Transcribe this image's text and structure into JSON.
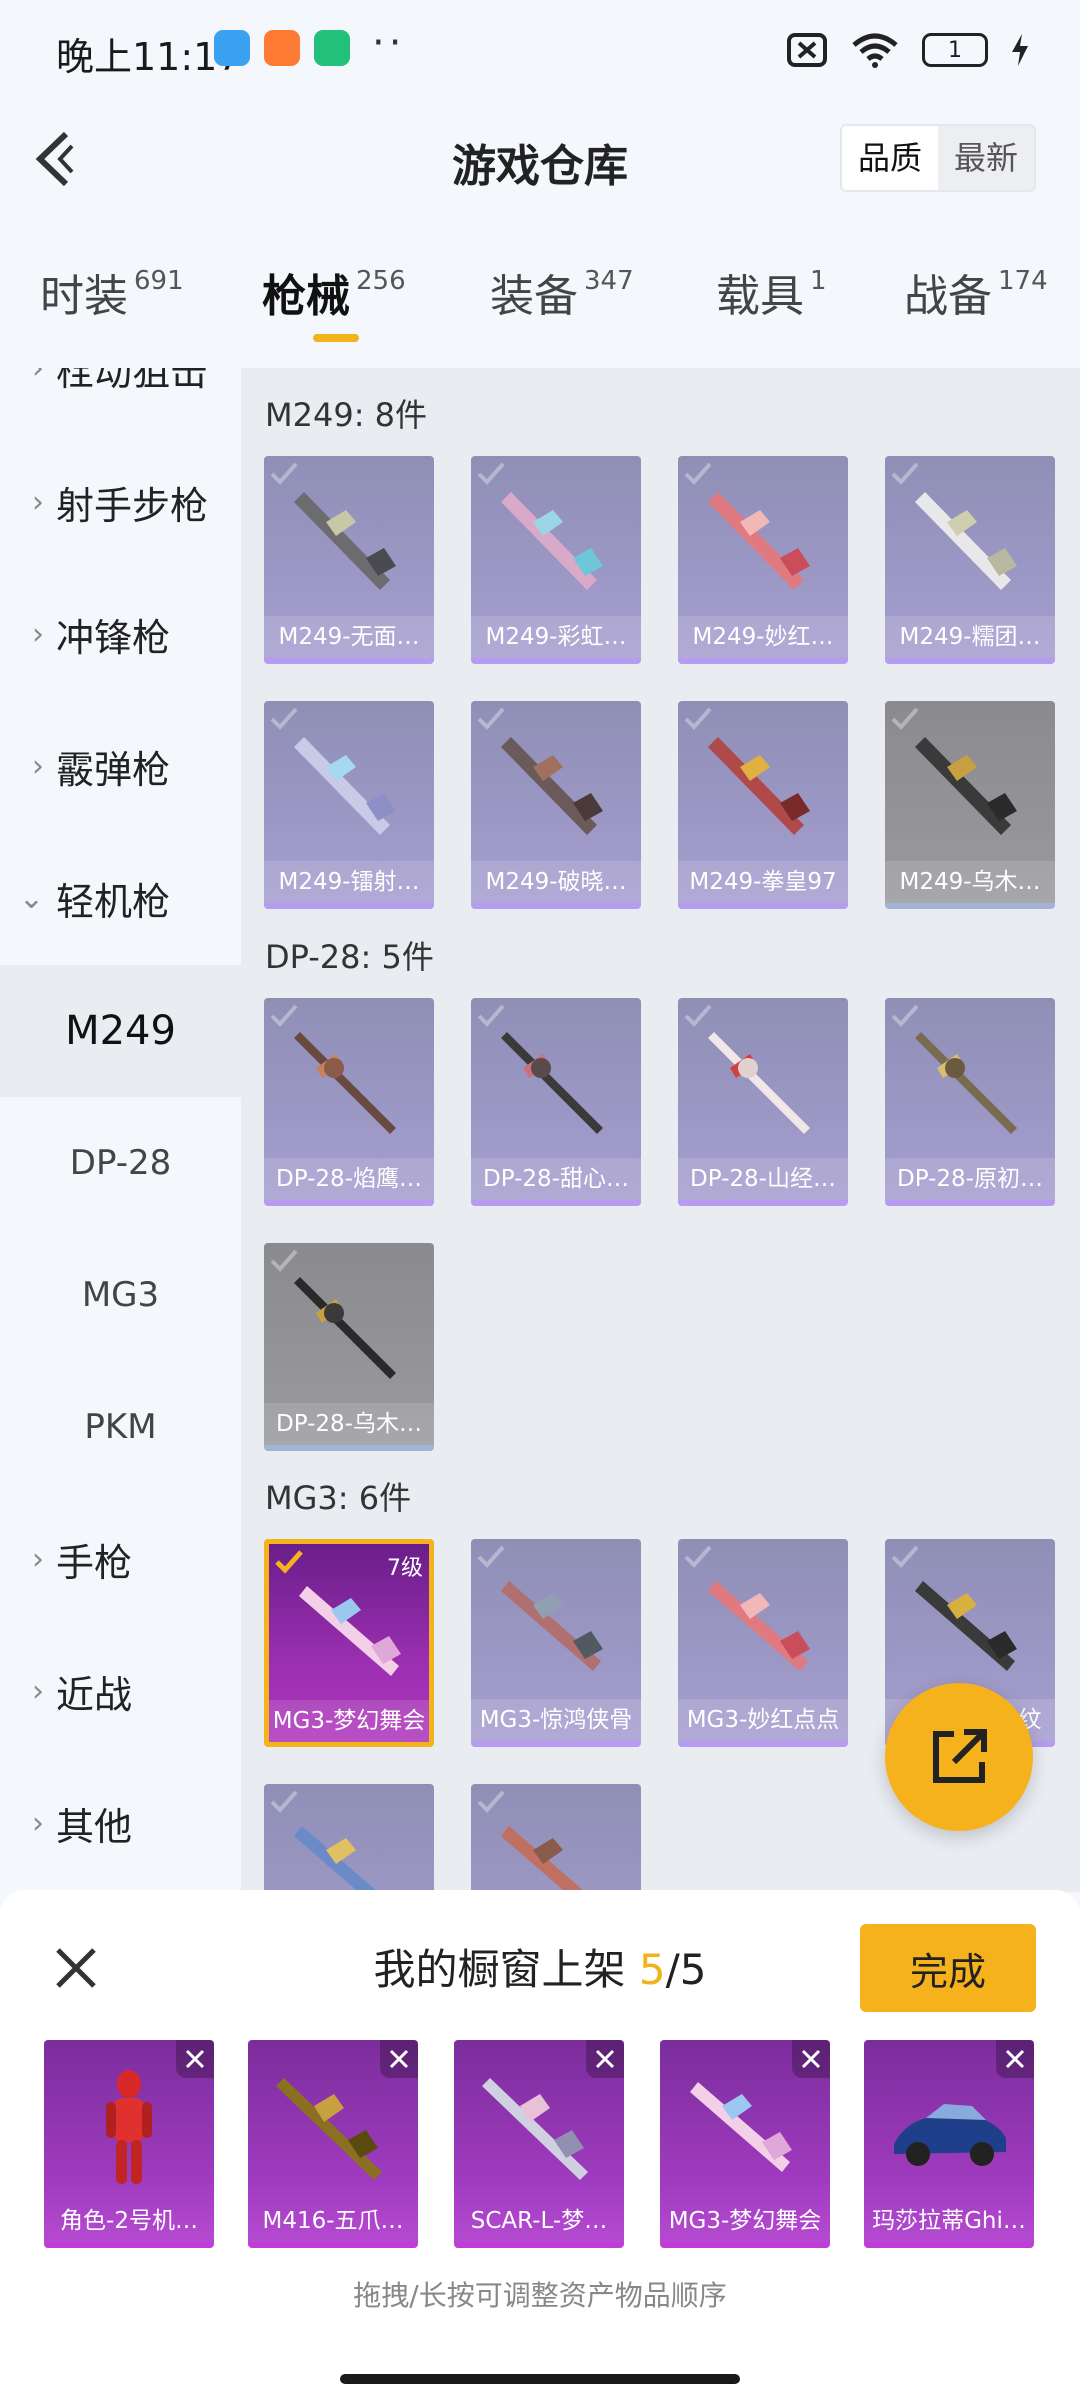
{
  "status_bar": {
    "time": "晚上11:17",
    "battery": "1"
  },
  "header": {
    "title": "游戏仓库",
    "sort_options": [
      "品质",
      "最新"
    ]
  },
  "tabs": [
    {
      "label": "时装",
      "count": "691"
    },
    {
      "label": "枪械",
      "count": "256"
    },
    {
      "label": "装备",
      "count": "347"
    },
    {
      "label": "载具",
      "count": "1"
    },
    {
      "label": "战备",
      "count": "174"
    }
  ],
  "sidebar": {
    "partial": "栓动狙击",
    "items": [
      "射手步枪",
      "冲锋枪",
      "霰弹枪",
      "轻机枪"
    ],
    "subitems": [
      "M249",
      "DP-28",
      "MG3",
      "PKM"
    ],
    "items_after": [
      "手枪",
      "近战",
      "其他"
    ]
  },
  "sections": [
    {
      "title": "M249: 8件",
      "items": [
        "M249-无面…",
        "M249-彩虹…",
        "M249-妙红…",
        "M249-糯团…",
        "M249-镭射…",
        "M249-破晓…",
        "M249-拳皇97",
        "M249-乌木…"
      ]
    },
    {
      "title": "DP-28: 5件",
      "items": [
        "DP-28-焰鹰…",
        "DP-28-甜心…",
        "DP-28-山经…",
        "DP-28-原初…",
        "DP-28-乌木…"
      ]
    },
    {
      "title": "MG3: 6件",
      "items": [
        "MG3-梦幻舞会",
        "MG3-惊鸿侠骨",
        "MG3-妙红点点",
        "纹"
      ],
      "level": "7级"
    }
  ],
  "sheet": {
    "title_prefix": "我的橱窗上架 ",
    "count": "5",
    "total": "/5",
    "done": "完成",
    "items": [
      "角色-2号机…",
      "M416-五爪…",
      "SCAR-L-梦…",
      "MG3-梦幻舞会",
      "玛莎拉蒂Ghi…"
    ],
    "hint": "拖拽/长按可调整资产物品顺序"
  },
  "colors": {
    "accent": "#f6b21c",
    "epic_purple": "#a03bbf",
    "card_purple": "#9b97c4"
  }
}
